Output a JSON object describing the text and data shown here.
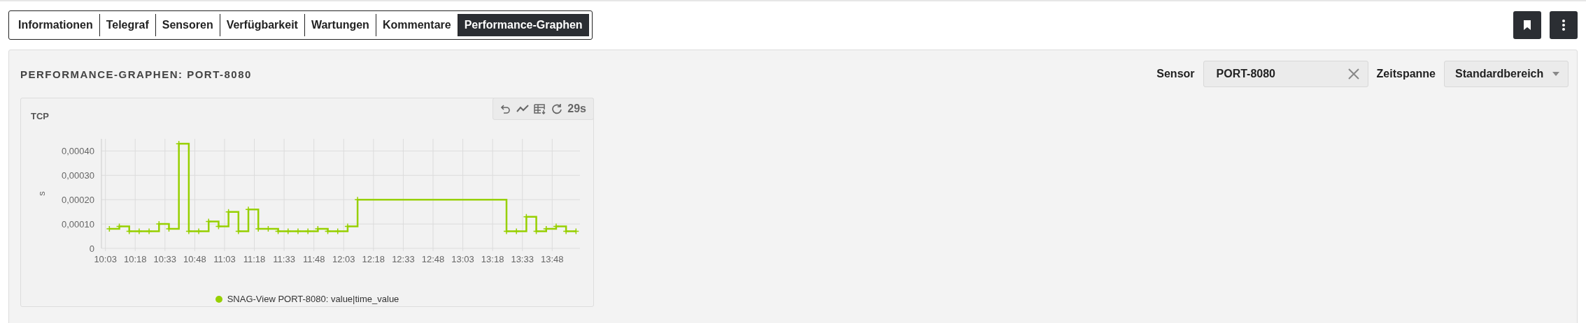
{
  "tabs": [
    {
      "label": "Informationen",
      "selected": false
    },
    {
      "label": "Telegraf",
      "selected": false
    },
    {
      "label": "Sensoren",
      "selected": false
    },
    {
      "label": "Verfügbarkeit",
      "selected": false
    },
    {
      "label": "Wartungen",
      "selected": false
    },
    {
      "label": "Kommentare",
      "selected": false
    },
    {
      "label": "Performance-Graphen",
      "selected": true
    }
  ],
  "panel": {
    "title": "PERFORMANCE-GRAPHEN: PORT-8080",
    "sensor": {
      "label": "Sensor",
      "value": "PORT-8080"
    },
    "timespan": {
      "label": "Zeitspanne",
      "value": "Standardbereich"
    },
    "graphs": [
      {
        "refresh": "29s",
        "chart_data": {
          "type": "line",
          "grid": true,
          "title": "TCP",
          "ylabel": "s",
          "x": [
            605,
            610,
            610,
            615,
            615,
            620,
            625,
            630,
            630,
            635,
            635,
            640,
            640,
            645,
            645,
            650,
            655,
            655,
            660,
            660,
            665,
            665,
            670,
            670,
            675,
            675,
            680,
            680,
            685,
            690,
            690,
            695,
            700,
            705,
            710,
            710,
            715,
            715,
            720,
            725,
            725,
            730,
            730,
            805,
            805,
            810,
            815,
            815,
            820,
            820,
            825,
            825,
            830,
            830,
            835,
            835,
            840
          ],
          "series": [
            {
              "name": "SNAG-View PORT-8080: value|time_value",
              "color": "#97d000",
              "marker": "cross",
              "values": [
                8e-05,
                8e-05,
                9e-05,
                9e-05,
                7e-05,
                7e-05,
                7e-05,
                7e-05,
                0.0001,
                0.0001,
                8e-05,
                8e-05,
                0.00043,
                0.00043,
                7e-05,
                7e-05,
                7e-05,
                0.00011,
                0.00011,
                9e-05,
                9e-05,
                0.00015,
                0.00015,
                7e-05,
                7e-05,
                0.00016,
                0.00016,
                8e-05,
                8e-05,
                8e-05,
                7e-05,
                7e-05,
                7e-05,
                7e-05,
                7e-05,
                8e-05,
                8e-05,
                7e-05,
                7e-05,
                7e-05,
                9e-05,
                9e-05,
                0.0002,
                0.0002,
                7e-05,
                7e-05,
                7e-05,
                0.00013,
                0.00013,
                7e-05,
                7e-05,
                8e-05,
                8e-05,
                9e-05,
                9e-05,
                7e-05,
                7e-05
              ]
            }
          ],
          "xlim": [
            601,
            842
          ],
          "ylim": [
            0,
            0.00045
          ],
          "xticks": [
            {
              "value": 603,
              "label": "10:03"
            },
            {
              "value": 618,
              "label": "10:18"
            },
            {
              "value": 633,
              "label": "10:33"
            },
            {
              "value": 648,
              "label": "10:48"
            },
            {
              "value": 663,
              "label": "11:03"
            },
            {
              "value": 678,
              "label": "11:18"
            },
            {
              "value": 693,
              "label": "11:33"
            },
            {
              "value": 708,
              "label": "11:48"
            },
            {
              "value": 723,
              "label": "12:03"
            },
            {
              "value": 738,
              "label": "12:18"
            },
            {
              "value": 753,
              "label": "12:33"
            },
            {
              "value": 768,
              "label": "12:48"
            },
            {
              "value": 783,
              "label": "13:03"
            },
            {
              "value": 798,
              "label": "13:18"
            },
            {
              "value": 813,
              "label": "13:33"
            },
            {
              "value": 828,
              "label": "13:48"
            }
          ],
          "yticks": [
            0,
            {
              "value": 0.0001,
              "label": "0,00010"
            },
            {
              "value": 0.0002,
              "label": "0,00020"
            },
            {
              "value": 0.0003,
              "label": "0,00030"
            },
            {
              "value": 0.0004,
              "label": "0,00040"
            }
          ]
        }
      }
    ]
  }
}
